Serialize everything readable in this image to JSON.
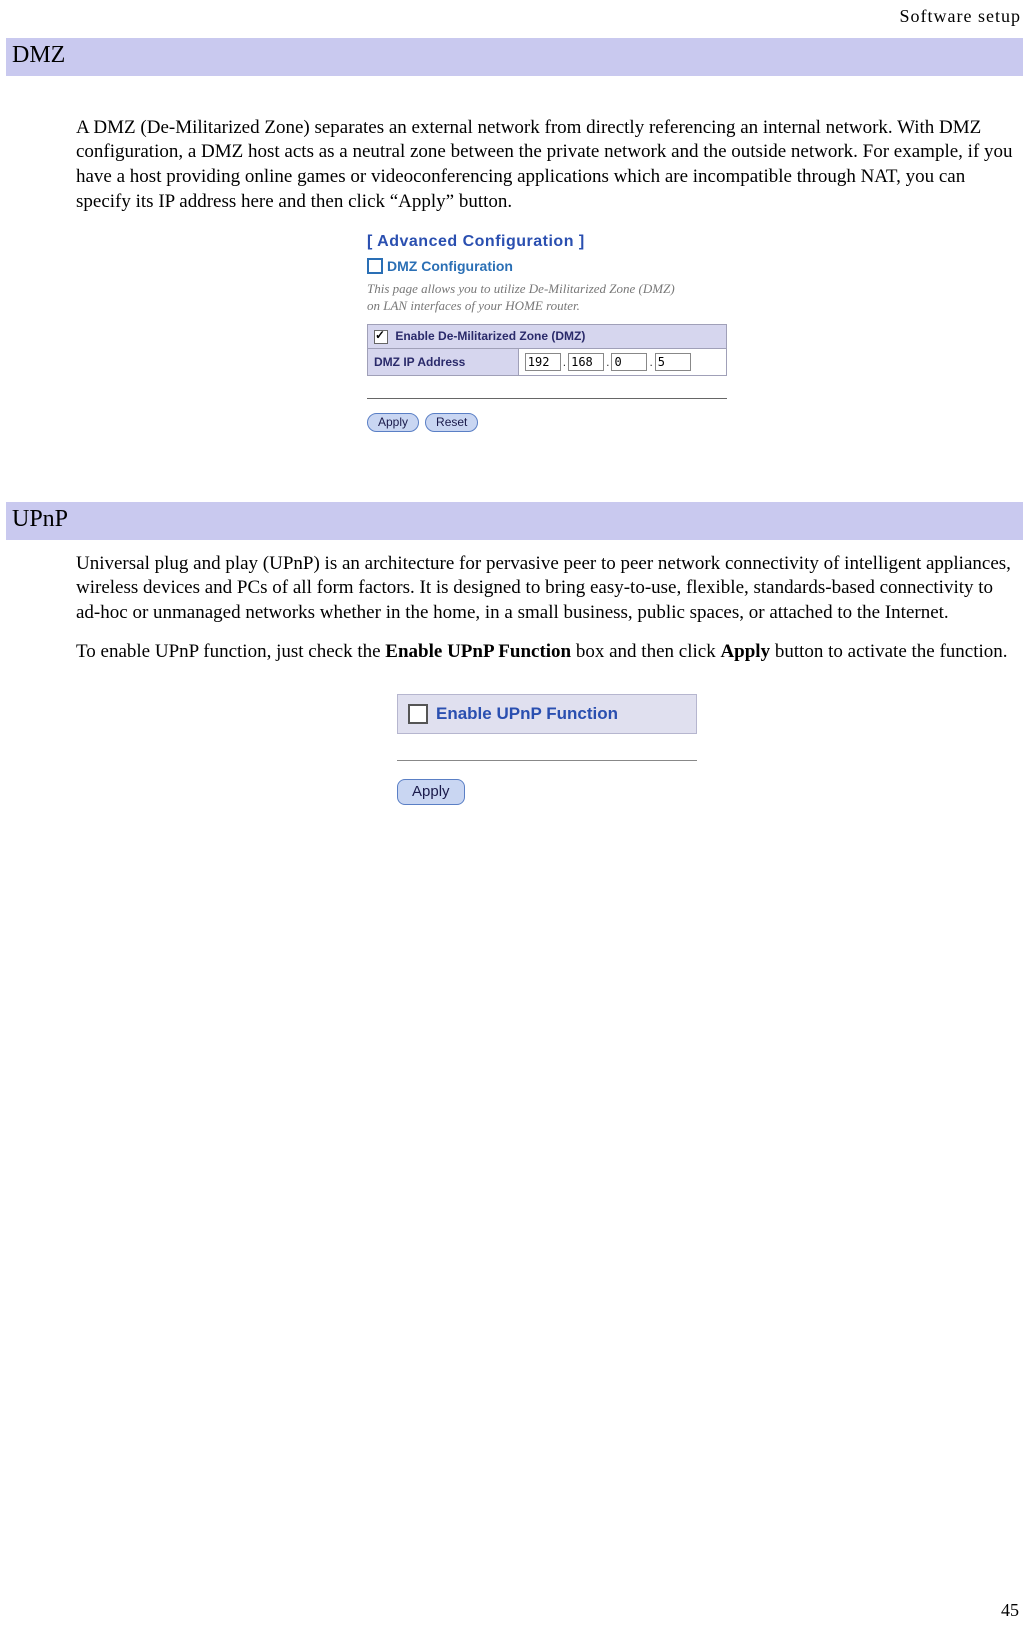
{
  "header": {
    "right": "Software  setup"
  },
  "sections": {
    "dmz": {
      "bar_title": "DMZ",
      "description": "A DMZ (De-Militarized Zone) separates an external network from directly referencing an internal network. With DMZ configuration, a DMZ host acts as a neutral zone between the private network and the outside network. For example, if you have a host providing online games or videoconferencing applications which are incompatible through NAT, you can specify its IP address here and then click “Apply” button."
    },
    "upnp": {
      "bar_title": "UPnP",
      "p1": "Universal plug and play (UPnP) is an architecture for pervasive peer to peer network connectivity of intelligent appliances, wireless devices and PCs of all form factors. It is designed to bring easy-to-use, flexible, standards-based connectivity to ad-hoc or unmanaged networks whether in the home, in a small business, public spaces, or attached to the Internet.",
      "p2_pre": "To enable UPnP function, just check the ",
      "p2_bold1": "Enable UPnP Function",
      "p2_mid": " box and then click ",
      "p2_bold2": "Apply",
      "p2_post": " button to activate the function."
    }
  },
  "dmz_panel": {
    "adv_title": "[ Advanced Configuration ]",
    "sub_title": "DMZ Configuration",
    "help_l1": "This page allows you to utilize De-Militarized Zone (DMZ)",
    "help_l2": "on LAN interfaces of your HOME router.",
    "enable_label": "Enable De-Militarized Zone (DMZ)",
    "enable_checked": true,
    "ip_row_label": "DMZ IP Address",
    "ip": {
      "a": "192",
      "b": "168",
      "c": "0",
      "d": "5"
    },
    "apply": "Apply",
    "reset": "Reset"
  },
  "upnp_panel": {
    "checkbox_label": "Enable UPnP Function",
    "checked": false,
    "apply": "Apply"
  },
  "page_number": "45"
}
